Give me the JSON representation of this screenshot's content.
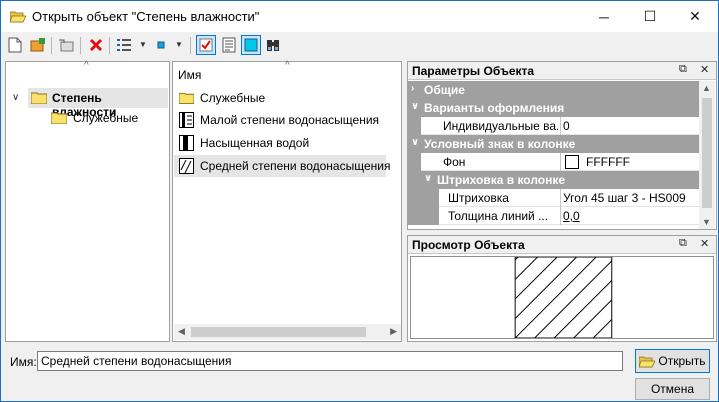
{
  "window": {
    "title": "Открыть объект \"Степень влажности\"",
    "icon": "folder-open-icon",
    "controls": {
      "minimize": "─",
      "maximize": "☐",
      "close": "✕"
    }
  },
  "toolbar": {
    "buttons": [
      "new-icon",
      "open-icon",
      "up-folder-icon",
      "delete-icon",
      "view-options-icon",
      "marker-icon",
      "check-icon",
      "list-icon",
      "preview-icon",
      "binoculars-icon"
    ]
  },
  "tree": {
    "root_label": "Степень влажности",
    "child_label": "Служебные"
  },
  "list": {
    "header": "Имя",
    "items": [
      {
        "label": "Служебные",
        "icon": "folder-icon"
      },
      {
        "label": "Малой степени водонасыщения",
        "icon": "hatch-stripes-icon"
      },
      {
        "label": "Насыщенная водой",
        "icon": "hatch-solid-icon"
      },
      {
        "label": "Средней степени водонасыщения",
        "icon": "hatch-diagonal-icon"
      }
    ],
    "selected": "Средней степени водонасыщения"
  },
  "properties": {
    "title": "Параметры Объекта",
    "categories": {
      "general": "Общие",
      "variants": "Варианты оформления",
      "symbol": "Условный знак в колонке",
      "hatch": "Штриховка в колонке"
    },
    "rows": {
      "individual_label": "Индивидуальные ва...",
      "individual_value": "0",
      "background_label": "Фон",
      "background_value": "FFFFFF",
      "hatch_label": "Штриховка",
      "hatch_value": "Угол 45 шаг 3 - HS009",
      "line_width_label": "Толщина линий ...",
      "line_width_value": "0,0"
    }
  },
  "preview": {
    "title": "Просмотр Объекта"
  },
  "bottom": {
    "name_label": "Имя:",
    "name_value": "Средней степени водонасыщения",
    "open_button": "Открыть",
    "cancel_button": "Отмена"
  },
  "colors": {
    "accent": "#0078d7",
    "category_bg": "#a0a0a0",
    "folder": "#f8e26a",
    "delete": "#e01010"
  }
}
